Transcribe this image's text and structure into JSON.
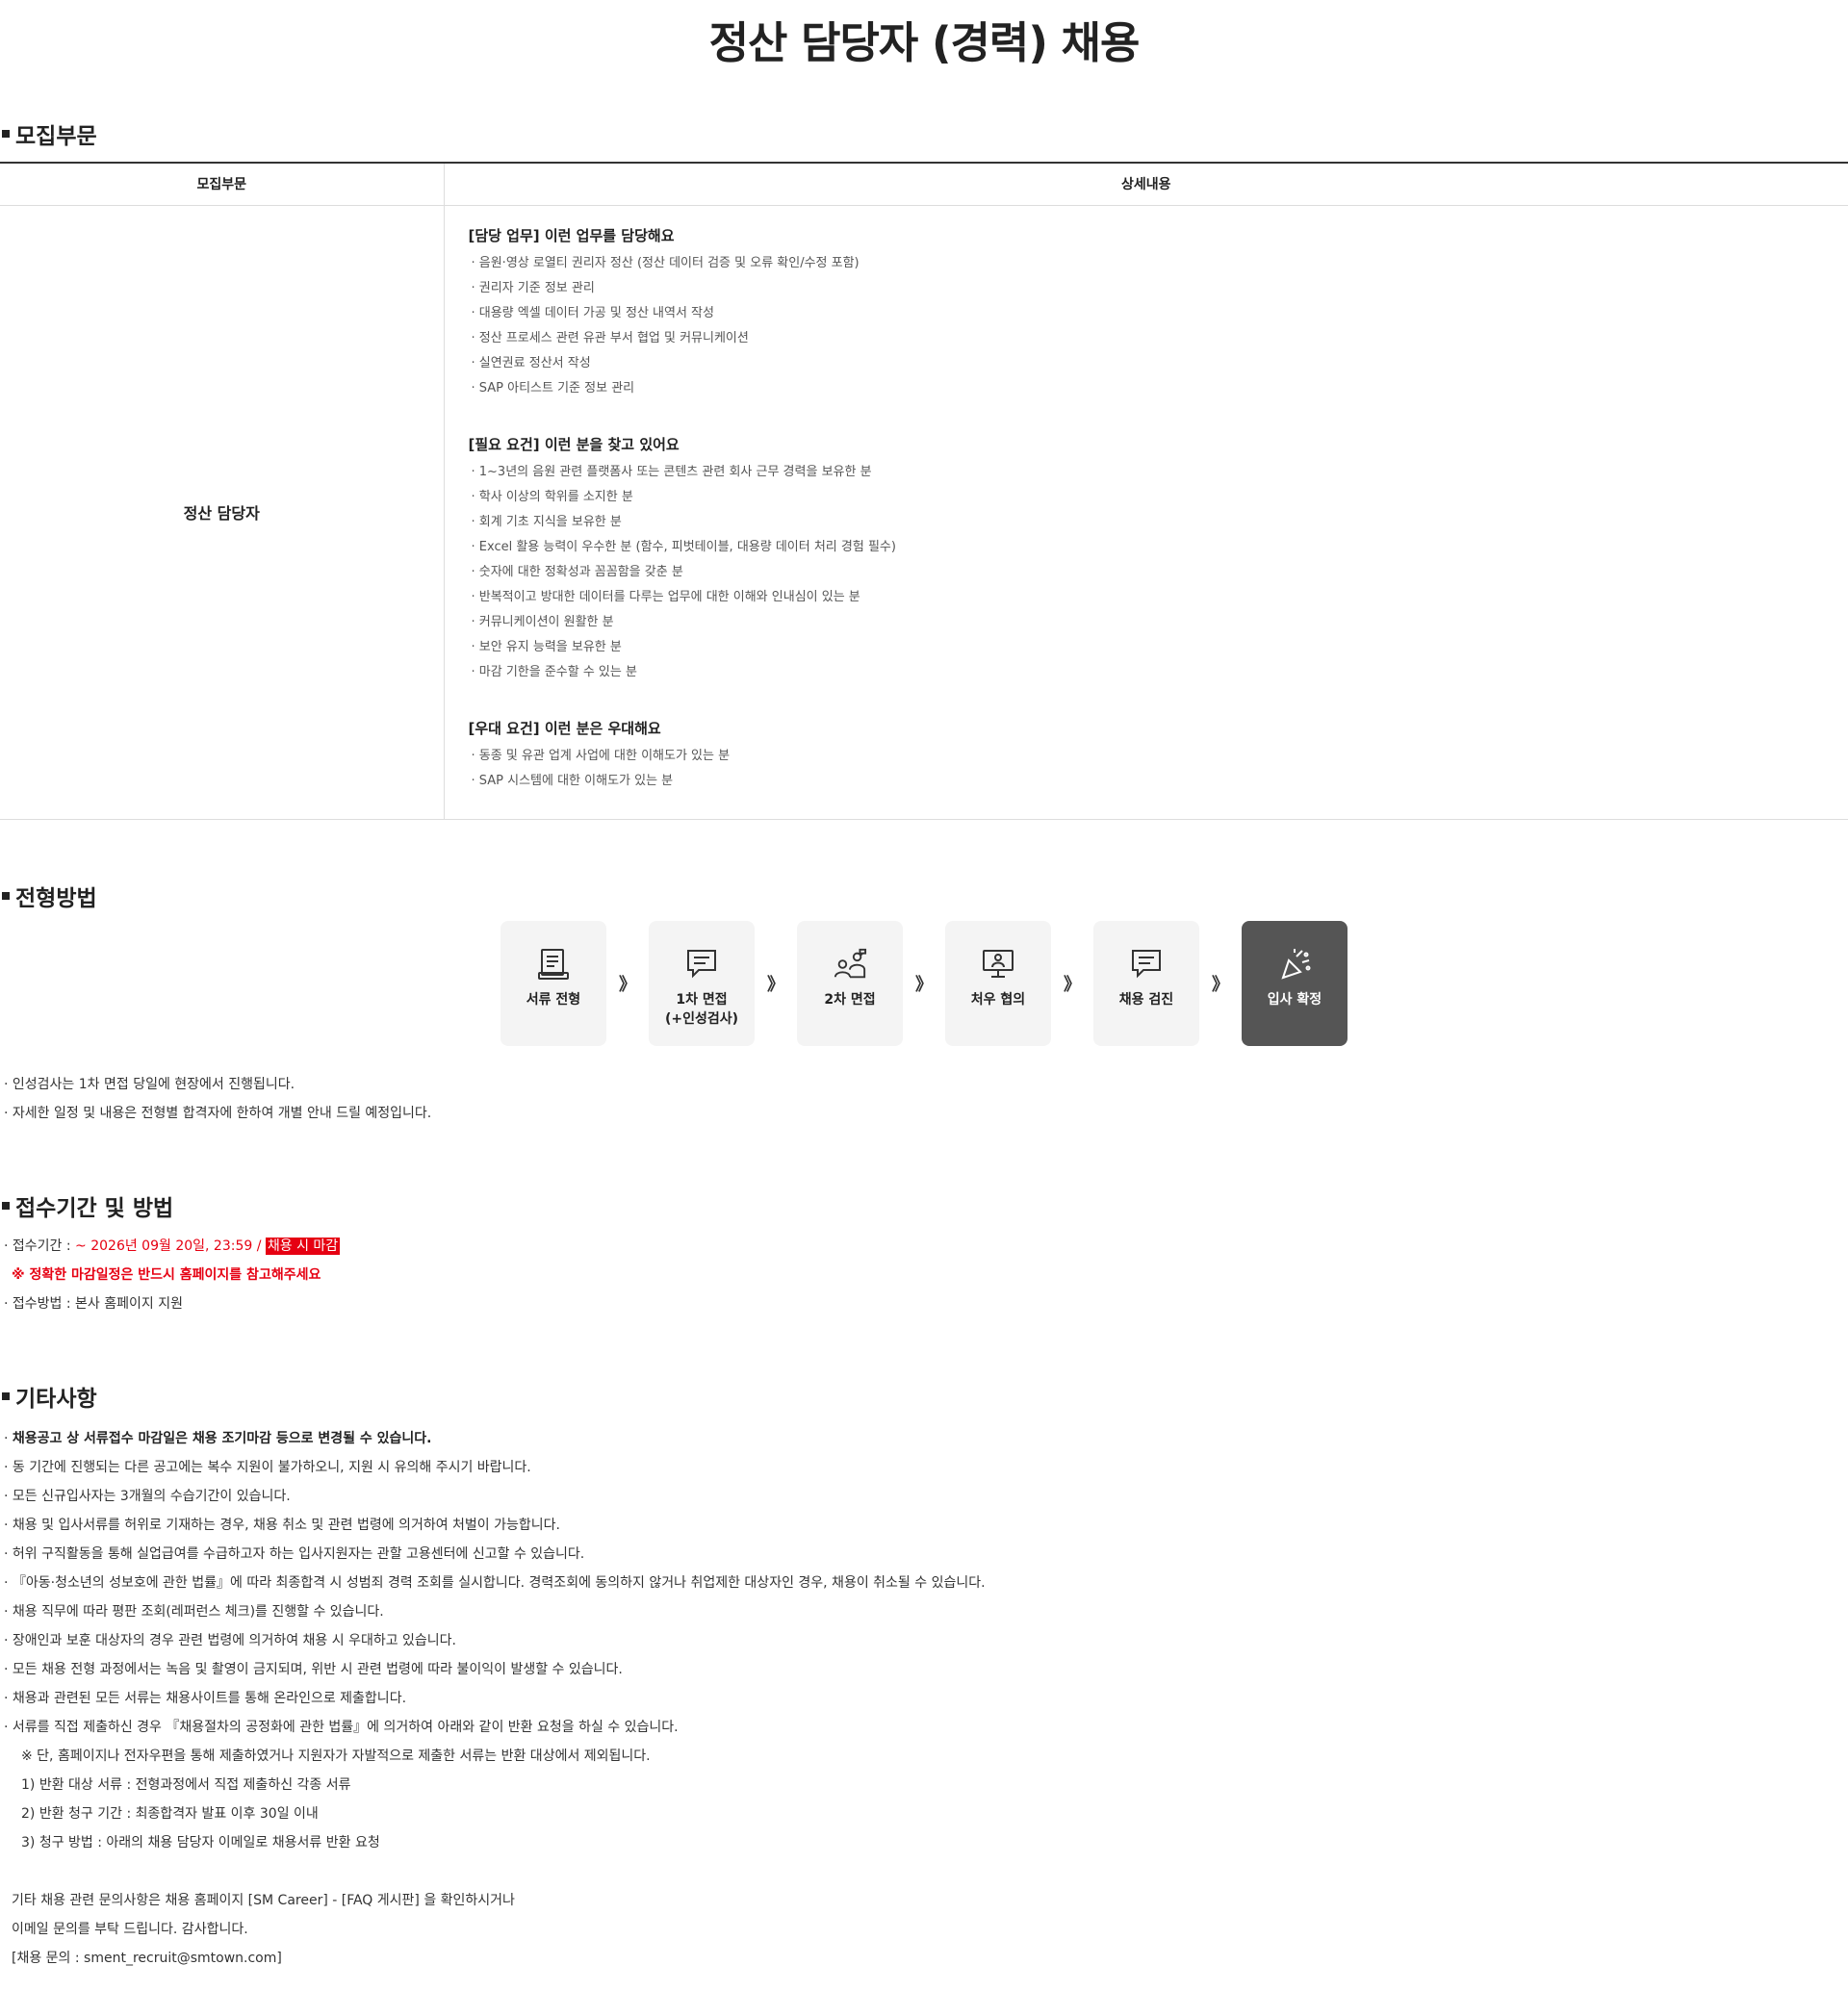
{
  "page_title": "정산 담당자 (경력) 채용",
  "sections": {
    "recruit": "모집부문",
    "process": "전형방법",
    "apply": "접수기간 및 방법",
    "etc": "기타사항"
  },
  "table": {
    "col1_header": "모집부문",
    "col2_header": "상세내용",
    "position": "정산 담당자",
    "duties_title": "[담당 업무] 이런 업무를 담당해요",
    "duties": [
      "· 음원·영상 로열티 권리자 정산 (정산 데이터 검증 및 오류 확인/수정 포함)",
      "· 권리자 기준 정보 관리",
      "· 대용량 엑셀 데이터 가공 및 정산 내역서 작성",
      "· 정산 프로세스 관련 유관 부서 협업 및 커뮤니케이션",
      "· 실연권료 정산서 작성",
      "· SAP 아티스트 기준 정보 관리"
    ],
    "requirements_title": "[필요 요건] 이런 분을 찾고 있어요",
    "requirements": [
      "· 1~3년의 음원 관련 플랫폼사 또는 콘텐츠 관련 회사 근무 경력을 보유한 분",
      "· 학사 이상의 학위를 소지한 분",
      "· 회계 기초 지식을 보유한 분",
      "· Excel 활용 능력이 우수한 분 (함수, 피벗테이블, 대용량 데이터 처리 경험 필수)",
      "· 숫자에 대한 정확성과 꼼꼼함을 갖춘 분",
      "· 반복적이고 방대한 데이터를 다루는 업무에 대한 이해와 인내심이 있는 분",
      "· 커뮤니케이션이 원활한 분",
      "· 보안 유지 능력을 보유한 분",
      "· 마감 기한을 준수할 수 있는 분"
    ],
    "preferred_title": "[우대 요건] 이런 분은 우대해요",
    "preferred": [
      "· 동종 및 유관 업계 사업에 대한 이해도가 있는 분",
      "· SAP 시스템에 대한 이해도가 있는 분"
    ]
  },
  "steps": {
    "s1": "서류 전형",
    "s2a": "1차 면접",
    "s2b": "(+인성검사)",
    "s3": "2차 면접",
    "s4": "처우 협의",
    "s5": "채용 검진",
    "s6": "입사 확정",
    "arrow": "》"
  },
  "process_notes": [
    "· 인성검사는 1차 면접 당일에 현장에서 진행됩니다.",
    "· 자세한 일정 및 내용은 전형별 합격자에 한하여 개별 안내 드릴 예정입니다."
  ],
  "apply": {
    "period_label": "· 접수기간 : ",
    "period_value": "~ 2026년 09월 20일, 23:59 / ",
    "period_badge": "채용 시 마감",
    "deadline_note": "※ 정확한 마감일정은 반드시 홈페이지를 참고해주세요",
    "method": "· 접수방법 : 본사 홈페이지 지원"
  },
  "etc": {
    "bold_line": "채용공고 상 서류접수 마감일은 채용 조기마감 등으로 변경될 수 있습니다.",
    "bullet": "· ",
    "lines": [
      "· 동 기간에 진행되는 다른 공고에는 복수 지원이 불가하오니, 지원 시 유의해 주시기 바랍니다.",
      "· 모든 신규입사자는 3개월의 수습기간이 있습니다.",
      "· 채용 및 입사서류를 허위로 기재하는 경우, 채용 취소 및 관련 법령에 의거하여 처벌이 가능합니다.",
      "· 허위 구직활동을 통해 실업급여를 수급하고자 하는 입사지원자는 관할 고용센터에 신고할 수 있습니다.",
      "· 『아동·청소년의 성보호에 관한 법률』에 따라 최종합격 시 성범죄 경력 조회를 실시합니다. 경력조회에 동의하지 않거나 취업제한 대상자인 경우, 채용이 취소될 수 있습니다.",
      "· 채용 직무에 따라 평판 조회(레퍼런스 체크)를 진행할 수 있습니다.",
      "· 장애인과 보훈 대상자의 경우 관련 법령에 의거하여 채용 시 우대하고 있습니다.",
      "· 모든 채용 전형 과정에서는 녹음 및 촬영이 금지되며, 위반 시 관련 법령에 따라 불이익이 발생할 수 있습니다.",
      "· 채용과 관련된 모든 서류는 채용사이트를 통해 온라인으로 제출합니다.",
      "· 서류를 직접 제출하신 경우 『채용절차의 공정화에 관한 법률』에 의거하여 아래와 같이 반환 요청을 하실 수 있습니다."
    ],
    "sub_lines": [
      "※ 단, 홈페이지나 전자우편을 통해 제출하였거나 지원자가 자발적으로 제출한 서류는 반환 대상에서 제외됩니다.",
      "1) 반환 대상 서류 : 전형과정에서 직접 제출하신 각종 서류",
      "2) 반환 청구 기간 : 최종합격자 발표 이후 30일 이내",
      "3) 청구 방법 : 아래의 채용 담당자 이메일로 채용서류 반환 요청"
    ],
    "contact_lines": [
      "기타 채용 관련 문의사항은 채용 홈페이지 [SM Career] - [FAQ 게시판] 을 확인하시거나",
      "이메일 문의를 부탁 드립니다. 감사합니다.",
      "[채용 문의 : sment_recruit@smtown.com]"
    ]
  }
}
